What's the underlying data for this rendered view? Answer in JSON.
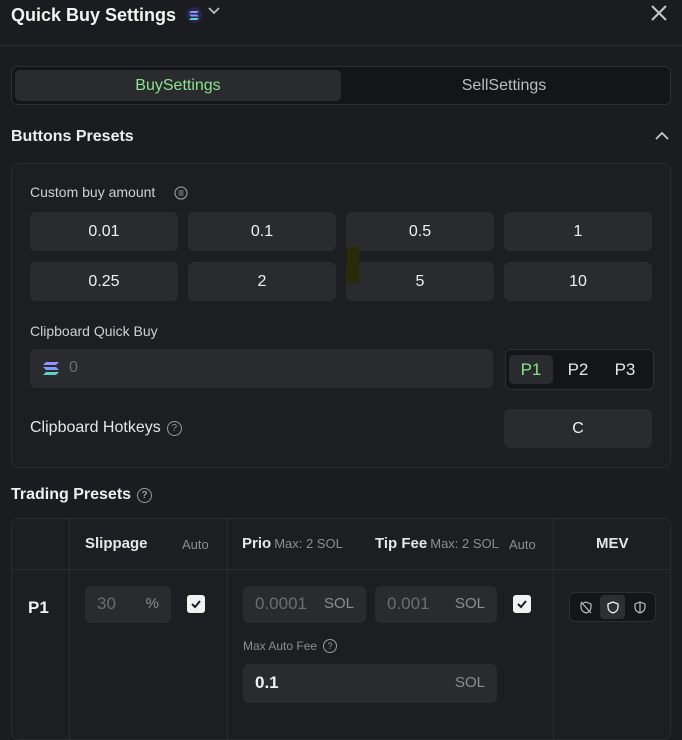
{
  "header": {
    "title": "Quick Buy Settings"
  },
  "tabs": {
    "buy": "BuySettings",
    "sell": "SellSettings"
  },
  "buttons_presets": {
    "title": "Buttons Presets",
    "custom_label": "Custom buy amount",
    "amounts": [
      "0.01",
      "0.1",
      "0.5",
      "1",
      "0.25",
      "2",
      "5",
      "10"
    ],
    "clipboard_label": "Clipboard Quick Buy",
    "clipboard_value": "0",
    "presets": [
      "P1",
      "P2",
      "P3"
    ],
    "active_preset": "P1",
    "hotkeys_label": "Clipboard Hotkeys",
    "hotkey_value": "C"
  },
  "trading_presets": {
    "title": "Trading Presets",
    "headers": {
      "slippage": "Slippage",
      "auto": "Auto",
      "prio": "Prio",
      "prio_max": "Max: 2 SOL",
      "tip": "Tip Fee",
      "tip_max": "Max: 2 SOL",
      "tip_auto": "Auto",
      "mev": "MEV"
    },
    "row": {
      "label": "P1",
      "slippage": "30",
      "slippage_unit": "%",
      "prio": "0.0001",
      "prio_unit": "SOL",
      "tip": "0.001",
      "tip_unit": "SOL",
      "max_auto_fee_label": "Max Auto Fee",
      "max_auto_fee": "0.1",
      "max_auto_fee_unit": "SOL"
    }
  },
  "colors": {
    "accent_green": "#8be38b",
    "background": "#1b1c1f",
    "surface": "#2a2b2f"
  }
}
